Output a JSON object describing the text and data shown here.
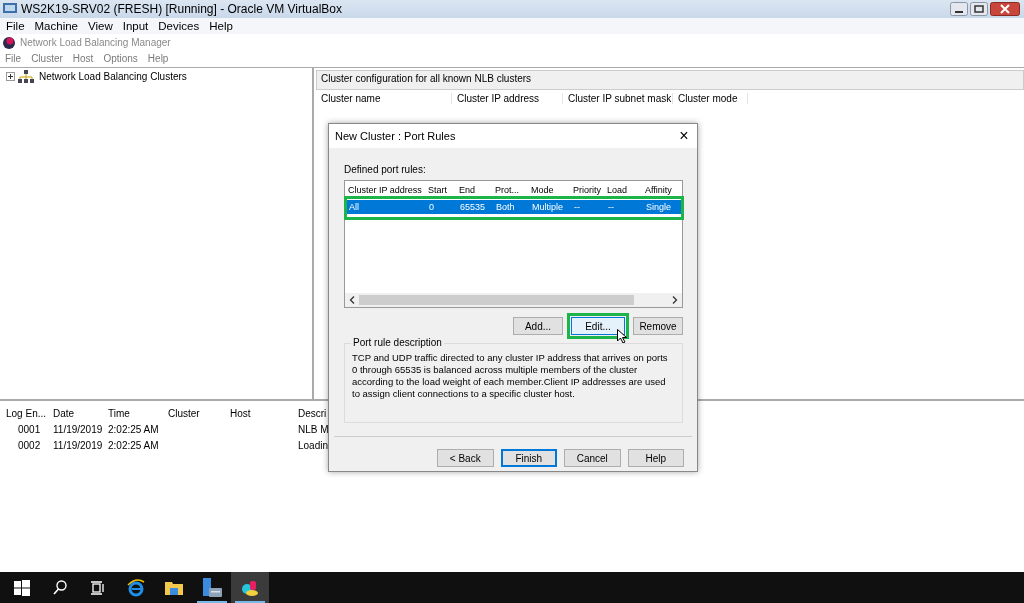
{
  "vm_window": {
    "title": "WS2K19-SRV02 (FRESH) [Running] - Oracle VM VirtualBox",
    "menu": [
      "File",
      "Machine",
      "View",
      "Input",
      "Devices",
      "Help"
    ]
  },
  "app": {
    "title": "Network Load Balancing Manager",
    "menu": [
      "File",
      "Cluster",
      "Host",
      "Options",
      "Help"
    ]
  },
  "tree": [
    {
      "label": "Network Load Balancing Clusters",
      "expanded": false,
      "selected": false
    }
  ],
  "cluster_list": {
    "caption": "Cluster configuration for all known NLB clusters",
    "columns": [
      "Cluster name",
      "Cluster IP address",
      "Cluster IP subnet mask",
      "Cluster mode"
    ]
  },
  "log": {
    "columns": [
      "Log En...",
      "Date",
      "Time",
      "Cluster",
      "Host",
      "Descri"
    ],
    "rows": [
      [
        "0001",
        "11/19/2019",
        "2:02:25 AM",
        "",
        "",
        "NLB M"
      ],
      [
        "0002",
        "11/19/2019",
        "2:02:25 AM",
        "",
        "",
        "Loadin"
      ]
    ]
  },
  "dialog": {
    "title": "New Cluster :  Port Rules",
    "close": "×",
    "list_label": "Defined port rules:",
    "columns": [
      "Cluster IP address",
      "Start",
      "End",
      "Prot...",
      "Mode",
      "Priority",
      "Load",
      "Affinity"
    ],
    "rules": [
      {
        "cells": [
          "All",
          "0",
          "65535",
          "Both",
          "Multiple",
          "--",
          "--",
          "Single"
        ],
        "selected": true
      }
    ],
    "rule_buttons": [
      {
        "label": "Add...",
        "highlighted": false
      },
      {
        "label": "Edit...",
        "highlighted": true
      },
      {
        "label": "Remove",
        "highlighted": false
      }
    ],
    "description_label": "Port rule description",
    "description": "TCP and UDP traffic directed to any cluster IP address that arrives on ports 0 through 65535 is balanced across multiple members of the cluster according to the load weight of each member.Client IP addresses are used to assign client connections to a specific cluster host.",
    "buttons": [
      {
        "label": "< Back",
        "default": false
      },
      {
        "label": "Finish",
        "default": true
      },
      {
        "label": "Cancel",
        "default": false
      },
      {
        "label": "Help",
        "default": false
      }
    ]
  },
  "taskbar": [
    {
      "kind": "start",
      "selected": false,
      "running": false
    },
    {
      "kind": "search",
      "selected": false,
      "running": false
    },
    {
      "kind": "taskview",
      "selected": false,
      "running": false
    },
    {
      "kind": "browser",
      "selected": false,
      "running": false
    },
    {
      "kind": "folder",
      "selected": false,
      "running": false
    },
    {
      "kind": "server",
      "selected": false,
      "running": true
    },
    {
      "kind": "nlb",
      "selected": true,
      "running": true
    }
  ]
}
